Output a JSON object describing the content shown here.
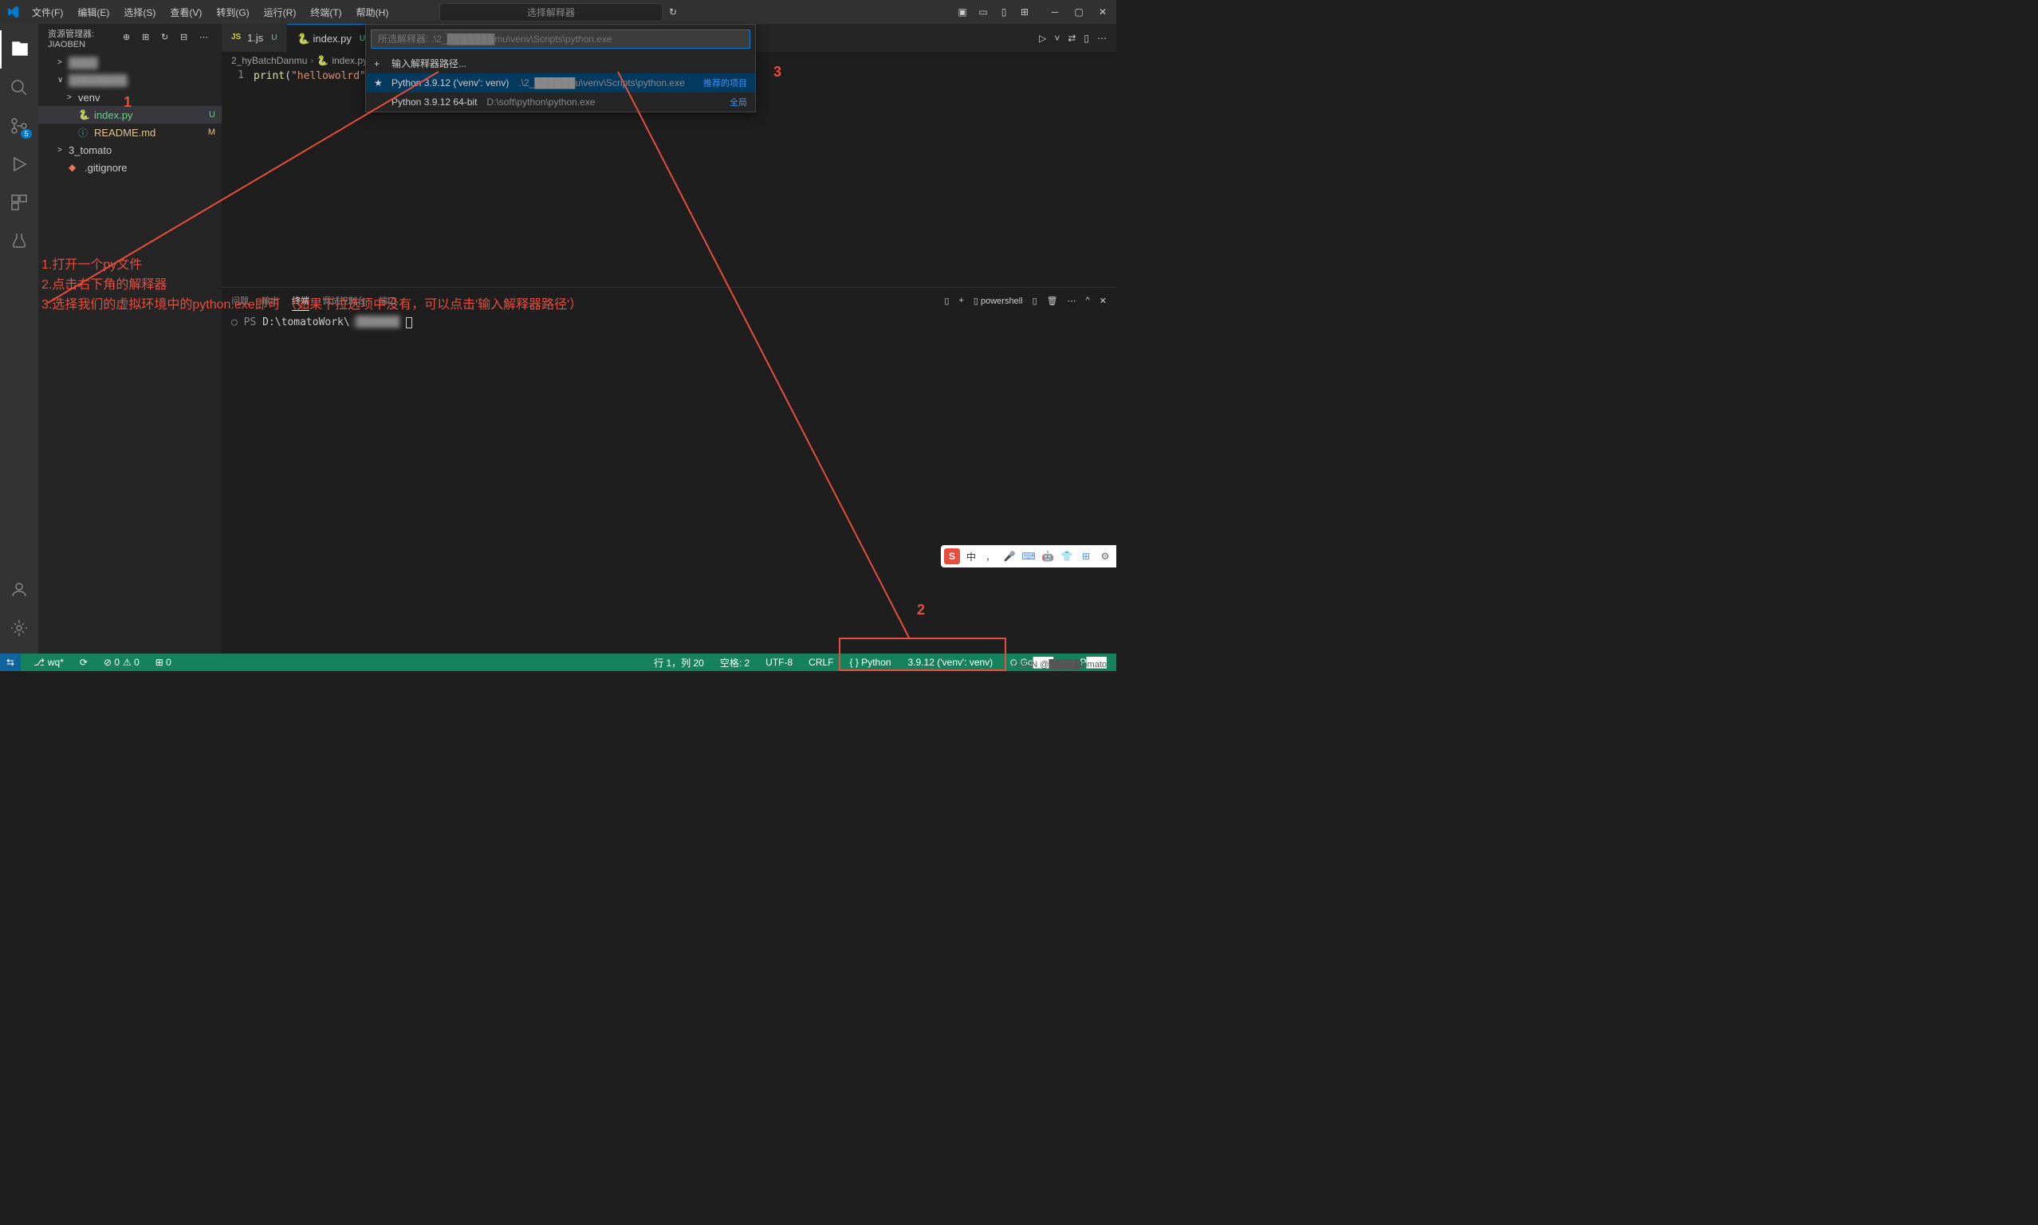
{
  "menu": {
    "file": "文件(F)",
    "edit": "编辑(E)",
    "selection": "选择(S)",
    "view": "查看(V)",
    "go": "转到(G)",
    "run": "运行(R)",
    "terminal": "终端(T)",
    "help": "帮助(H)"
  },
  "titlebar": {
    "center": "选择解释器",
    "refresh_icon": "↻"
  },
  "sidebar": {
    "title": "资源管理器: JIAOBEN",
    "items": [
      {
        "label": "████",
        "badge": "",
        "indent": 1,
        "chevron": ">",
        "masked": true
      },
      {
        "label": "████████",
        "badge": "",
        "indent": 1,
        "chevron": "∨",
        "masked": true
      },
      {
        "label": "venv",
        "badge": "",
        "indent": 2,
        "chevron": ">"
      },
      {
        "label": "index.py",
        "badge": "U",
        "indent": 2,
        "chevron": "",
        "selected": true,
        "icon": "python"
      },
      {
        "label": "README.md",
        "badge": "M",
        "indent": 2,
        "chevron": "",
        "icon": "info"
      },
      {
        "label": "3_tomato",
        "badge": "",
        "indent": 1,
        "chevron": ">"
      },
      {
        "label": ".gitignore",
        "badge": "",
        "indent": 1,
        "chevron": "",
        "icon": "git"
      }
    ]
  },
  "activity": {
    "badge_scm": "5"
  },
  "tabs": [
    {
      "label": "1.js",
      "icon": "JS",
      "status": "U",
      "active": false
    },
    {
      "label": "index.py",
      "icon": "python",
      "status": "U",
      "active": true
    }
  ],
  "breadcrumb": {
    "path1": "2_hyBatchDanmu",
    "path2": "index.py"
  },
  "editor": {
    "line1_num": "1",
    "line1_func": "print",
    "line1_paren_open": "(",
    "line1_string": "\"hellowolrd\"",
    "line1_paren_close": ")"
  },
  "picker": {
    "placeholder": "所选解释器: .\\2_███████mu\\venv\\Scripts\\python.exe",
    "enter_path": "输入解释器路径...",
    "item1_main": "Python 3.9.12 ('venv': venv)",
    "item1_sub": ".\\2_██████u\\venv\\Scripts\\python.exe",
    "item1_right": "推荐的项目",
    "item2_main": "Python 3.9.12 64-bit",
    "item2_sub": "D:\\soft\\python\\python.exe",
    "item2_right": "全局"
  },
  "panel": {
    "tabs": {
      "problems": "问题",
      "output": "输出",
      "terminal": "终端",
      "debug": "调试控制台",
      "ports": "端口"
    },
    "label": "powershell",
    "prompt_prefix": "○ PS ",
    "prompt_path": "D:\\tomatoWork\\",
    "prompt_masked": "j███████"
  },
  "status": {
    "remote": "⇆",
    "branch": "wq*",
    "sync": "⟳",
    "errors": "⊘ 0",
    "warnings": "⚠ 0",
    "ports": "⊞ 0",
    "position": "行 1，列 20",
    "spaces": "空格: 2",
    "encoding": "UTF-8",
    "eol": "CRLF",
    "language": "{ } Python",
    "interpreter": "3.9.12 ('venv': venv)",
    "golive": "⊙ Go███",
    "prettier": "⊘ P███"
  },
  "annotations": {
    "marker1": "1",
    "marker2": "2",
    "marker3": "3",
    "text1": "1.打开一个py文件",
    "text2": "2.点击右下角的解释器",
    "text3": "3.选择我们的虚拟环境中的python.exe即可 （如果下拉选项中没有，可以点击'输入解释器路径'）"
  },
  "ime": {
    "logo": "S",
    "lang": "中"
  },
  "watermark": "CSDN @█████tomato"
}
